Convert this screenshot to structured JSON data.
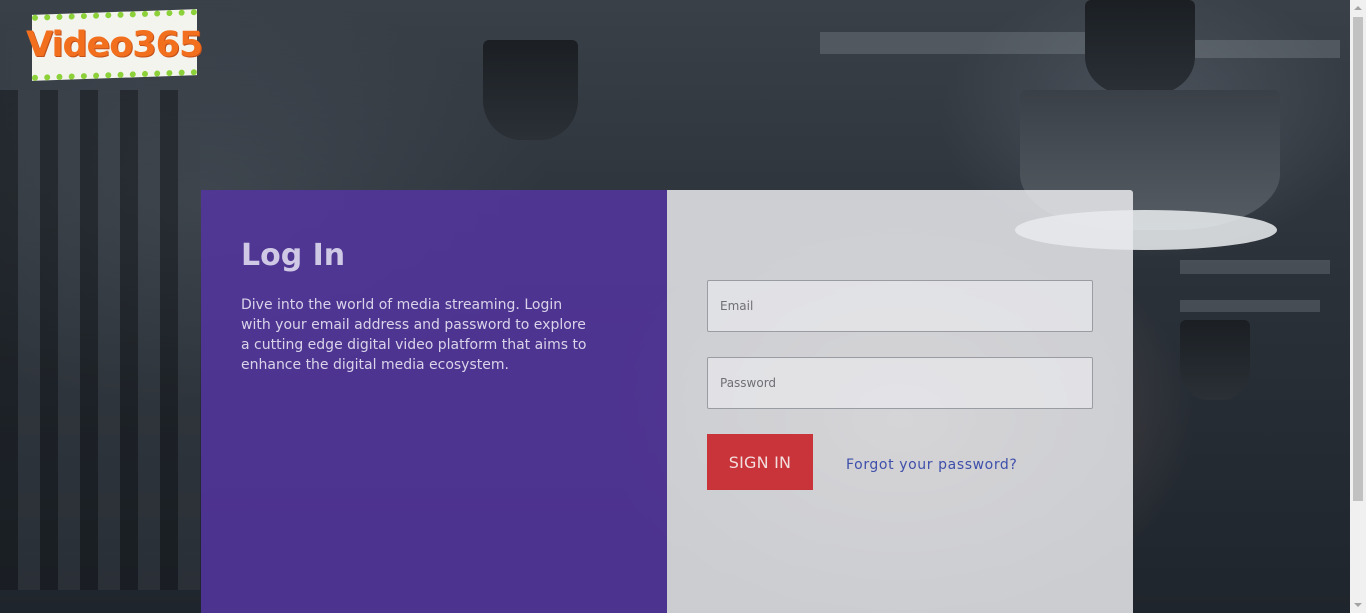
{
  "brand": {
    "logo_text": "Video365"
  },
  "login": {
    "title": "Log In",
    "description": "Dive into the world of media streaming. Login with your email address and password to explore a cutting edge digital video platform that aims to enhance the digital media ecosystem.",
    "email_placeholder": "Email",
    "password_placeholder": "Password",
    "signin_label": "SIGN IN",
    "forgot_label": "Forgot your password?"
  },
  "colors": {
    "left_panel": "#5436A0",
    "signin_button": "#C8343A",
    "link": "#3E4FAA",
    "logo_text": "#F2701D",
    "logo_border": "#8CD13A"
  }
}
